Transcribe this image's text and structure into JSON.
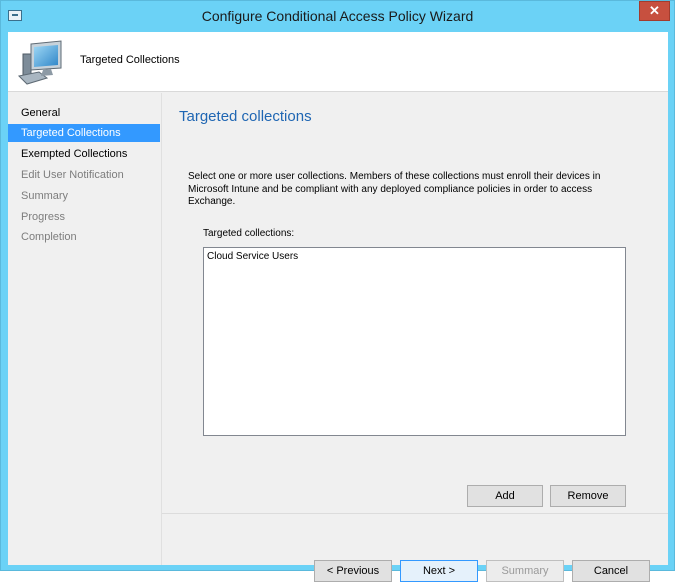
{
  "window": {
    "title": "Configure Conditional Access Policy Wizard",
    "close_glyph": "✕",
    "system_icon": "window-icon"
  },
  "header": {
    "title": "Targeted Collections",
    "icon": "computer-icon"
  },
  "nav": {
    "items": [
      {
        "label": "General",
        "state": "done"
      },
      {
        "label": "Targeted Collections",
        "state": "active"
      },
      {
        "label": "Exempted Collections",
        "state": "done"
      },
      {
        "label": "Edit User Notification",
        "state": "disabled"
      },
      {
        "label": "Summary",
        "state": "disabled"
      },
      {
        "label": "Progress",
        "state": "disabled"
      },
      {
        "label": "Completion",
        "state": "disabled"
      }
    ]
  },
  "main": {
    "title": "Targeted collections",
    "description": "Select one or more user collections. Members of these collections must enroll their devices in Microsoft Intune and be compliant with any deployed compliance policies in order to access Exchange.",
    "list_label": "Targeted collections:",
    "collections": [
      "Cloud Service Users"
    ],
    "add_label": "Add",
    "remove_label": "Remove"
  },
  "footer": {
    "previous_label": "< Previous",
    "next_label": "Next >",
    "summary_label": "Summary",
    "cancel_label": "Cancel"
  },
  "colors": {
    "titlebar": "#6bd2f6",
    "selection": "#3399ff",
    "page_title": "#1f66b3",
    "close_button": "#c7503f"
  }
}
